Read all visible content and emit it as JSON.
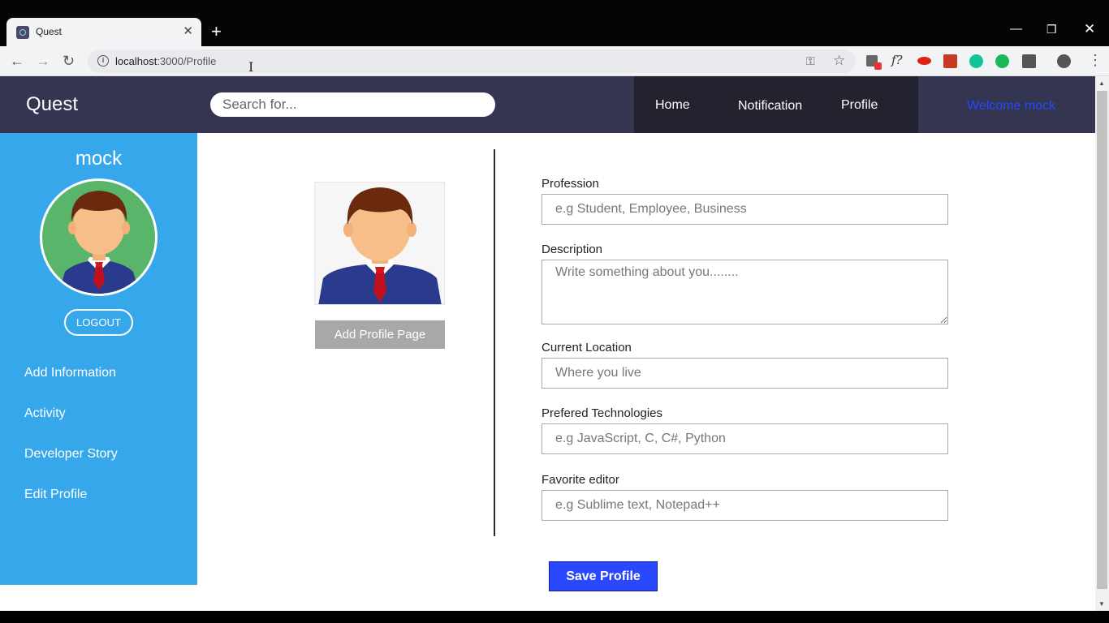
{
  "browser": {
    "tab_title": "Quest",
    "tab_close": "✕",
    "new_tab": "+",
    "url_host": "localhost",
    "url_path": ":3000/Profile",
    "window_controls": [
      "minimize-icon",
      "restore-icon",
      "close-icon"
    ]
  },
  "navbar": {
    "brand": "Quest",
    "search_placeholder": "Search for...",
    "links": [
      "Home",
      "Notification",
      "Profile"
    ],
    "welcome": "Welcome mock"
  },
  "sidebar": {
    "username": "mock",
    "logout": "LOGOUT",
    "items": [
      "Add Information",
      "Activity",
      "Developer Story",
      "Edit Profile"
    ]
  },
  "main": {
    "add_profile_button": "Add Profile Page",
    "save_button": "Save Profile",
    "fields": {
      "profession": {
        "label": "Profession",
        "placeholder": "e.g Student, Employee, Business"
      },
      "description": {
        "label": "Description",
        "placeholder": "Write something about you........"
      },
      "location": {
        "label": "Current Location",
        "placeholder": "Where you live"
      },
      "technologies": {
        "label": "Prefered Technologies",
        "placeholder": "e.g JavaScript, C, C#, Python"
      },
      "editor": {
        "label": "Favorite editor",
        "placeholder": "e.g Sublime text, Notepad++"
      }
    }
  },
  "colors": {
    "navbar": "#343550",
    "nav_links_bg": "#22232f",
    "sidebar": "#37a7ec",
    "welcome": "#2448ff",
    "save_button": "#2a49ff",
    "add_profile_button": "#a8a8a8"
  }
}
